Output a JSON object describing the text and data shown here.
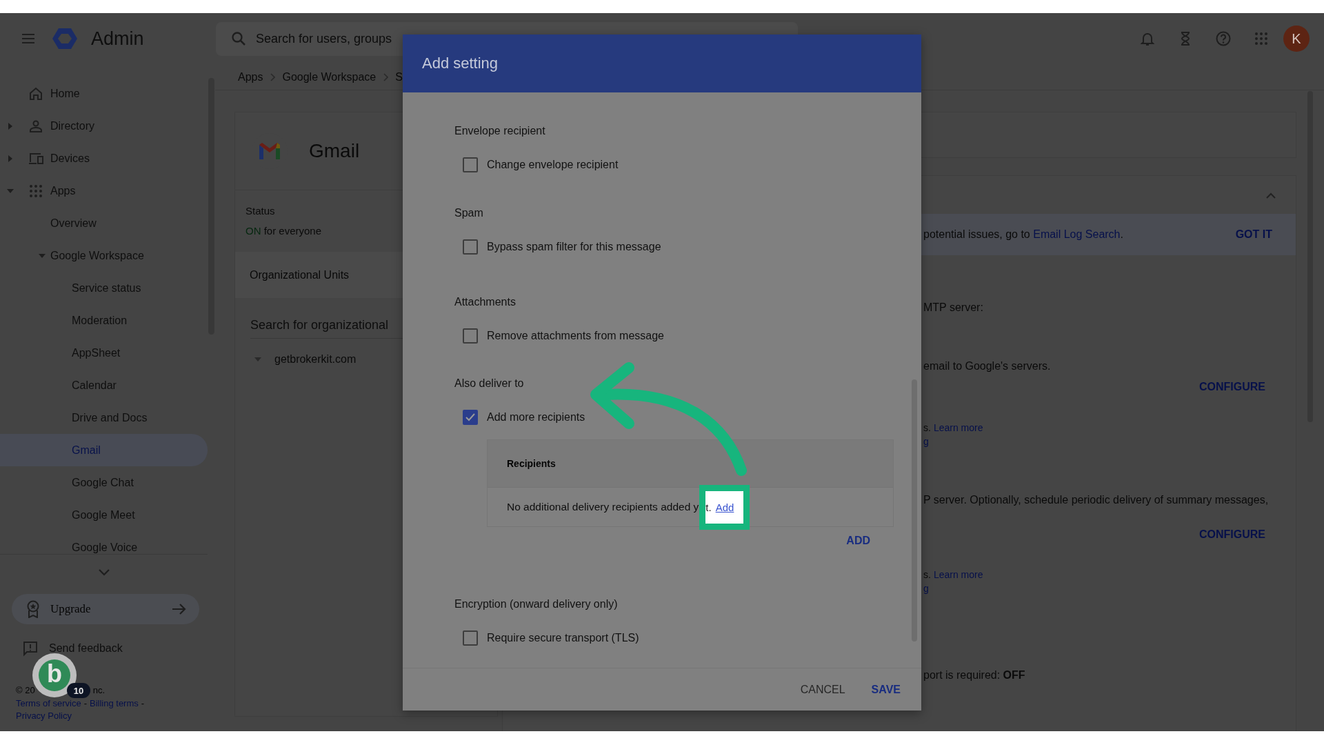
{
  "header": {
    "product": "Admin",
    "search": {
      "placeholder": "Search for users, groups"
    },
    "avatar": "K"
  },
  "breadcrumb": [
    "Apps",
    "Google Workspace",
    "S"
  ],
  "sidebar": {
    "nav": [
      {
        "label": "Home",
        "selected": false
      },
      {
        "label": "Directory",
        "expanded": false,
        "selected": false
      },
      {
        "label": "Devices",
        "expanded": false,
        "selected": false
      },
      {
        "label": "Apps",
        "expanded": true,
        "selected": false,
        "children": [
          {
            "label": "Overview",
            "selected": false
          },
          {
            "label": "Google Workspace",
            "expanded": true,
            "selected": false,
            "children": [
              {
                "label": "Service status",
                "selected": false
              },
              {
                "label": "Moderation",
                "selected": false
              },
              {
                "label": "AppSheet",
                "selected": false
              },
              {
                "label": "Calendar",
                "selected": false
              },
              {
                "label": "Drive and Docs",
                "selected": false
              },
              {
                "label": "Gmail",
                "selected": true
              },
              {
                "label": "Google Chat",
                "selected": false
              },
              {
                "label": "Google Meet",
                "selected": false
              },
              {
                "label": "Google Voice",
                "selected": false
              }
            ]
          }
        ]
      }
    ],
    "upgrade": "Upgrade",
    "feedback": "Send feedback",
    "footer": {
      "copyright_start": "© 20",
      "copyright_end": "nc.",
      "links": [
        "Terms of service",
        "Billing terms",
        "Privacy Policy"
      ],
      "separator": "-"
    }
  },
  "badge": {
    "letter": "b",
    "count": "10"
  },
  "gmail_card": {
    "title": "Gmail",
    "status_label": "Status",
    "status_state": "ON",
    "status_scope": "for everyone",
    "org_units": "Organizational Units",
    "org_search": {
      "placeholder": "Search for organizational"
    },
    "org_tree": [
      {
        "label": "getbrokerkit.com",
        "expanded": true
      }
    ]
  },
  "settings_panel": {
    "expanded": true,
    "banner": {
      "text": "potential issues, go to ",
      "link": "Email Log Search",
      "end": ".",
      "dismiss": "GOT IT"
    },
    "lines": [
      {
        "kind": "text",
        "text": "MTP server:"
      },
      {
        "kind": "text",
        "text": "email to Google's servers."
      },
      {
        "kind": "button",
        "text": "CONFIGURE"
      },
      {
        "kind": "note",
        "text": "s.",
        "link": "Learn more"
      },
      {
        "kind": "link",
        "text": "g"
      },
      {
        "kind": "text",
        "text": "P server. Optionally, schedule periodic delivery of summary messages,"
      },
      {
        "kind": "button",
        "text": "CONFIGURE"
      },
      {
        "kind": "note",
        "text": "s.",
        "link": "Learn more"
      },
      {
        "kind": "link",
        "text": "g"
      },
      {
        "kind": "text",
        "text": "port is required: **OFF**"
      }
    ]
  },
  "dialog": {
    "title": "Add setting",
    "sections": [
      {
        "label": "Envelope recipient",
        "options": [
          {
            "label": "Change envelope recipient",
            "checked": false
          }
        ]
      },
      {
        "label": "Spam",
        "options": [
          {
            "label": "Bypass spam filter for this message",
            "checked": false
          }
        ]
      },
      {
        "label": "Attachments",
        "options": [
          {
            "label": "Remove attachments from message",
            "checked": false
          }
        ]
      },
      {
        "label": "Also deliver to",
        "options": [
          {
            "label": "Add more recipients",
            "checked": true
          }
        ],
        "recipients": {
          "heading": "Recipients",
          "empty_text": "No additional delivery recipients added y",
          "highlight": {
            "text": "t.",
            "link": "Add"
          },
          "add_button": "ADD"
        }
      },
      {
        "label": "Encryption (onward delivery only)",
        "options": [
          {
            "label": "Require secure transport (TLS)",
            "checked": false
          }
        ]
      }
    ],
    "buttons": [
      {
        "label": "CANCEL",
        "kind": "secondary"
      },
      {
        "label": "SAVE",
        "kind": "primary"
      }
    ]
  }
}
